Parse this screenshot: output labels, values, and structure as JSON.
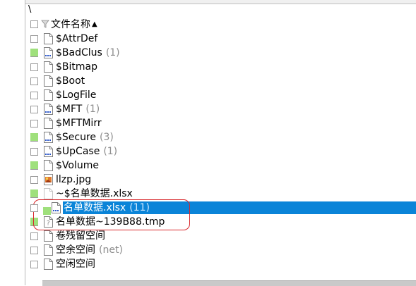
{
  "path": "\\",
  "header": {
    "column_label": "文件名称",
    "sort_indicator": "▲"
  },
  "files": [
    {
      "name": "$AttrDef",
      "count": "",
      "icon": "doc-icon",
      "marked": false
    },
    {
      "name": "$BadClus",
      "count": "(1)",
      "icon": "doc-multi-icon",
      "marked": true
    },
    {
      "name": "$Bitmap",
      "count": "",
      "icon": "doc-icon",
      "marked": false
    },
    {
      "name": "$Boot",
      "count": "",
      "icon": "doc-icon",
      "marked": false
    },
    {
      "name": "$LogFile",
      "count": "",
      "icon": "doc-icon",
      "marked": false
    },
    {
      "name": "$MFT",
      "count": "(1)",
      "icon": "doc-multi-icon",
      "marked": false
    },
    {
      "name": "$MFTMirr",
      "count": "",
      "icon": "doc-icon",
      "marked": false
    },
    {
      "name": "$Secure",
      "count": "(3)",
      "icon": "doc-multi-icon",
      "marked": true
    },
    {
      "name": "$UpCase",
      "count": "(1)",
      "icon": "doc-multi-icon",
      "marked": false
    },
    {
      "name": "$Volume",
      "count": "",
      "icon": "doc-icon",
      "marked": true
    },
    {
      "name": "llzp.jpg",
      "count": "",
      "icon": "image-icon",
      "marked": false
    },
    {
      "name": "~$名单数据.xlsx",
      "count": "",
      "icon": "doc-faded-icon",
      "marked": true
    },
    {
      "name": "名单数据.xlsx",
      "count": "(11)",
      "icon": "doc-multi-icon",
      "marked": true,
      "selected": true
    },
    {
      "name": "名单数据~139B88.tmp",
      "count": "",
      "icon": "unknown-doc-icon",
      "marked": true
    },
    {
      "name": "卷残留空间",
      "count": "",
      "icon": "doc-icon",
      "marked": false
    },
    {
      "name": "空余空间",
      "count": "(net)",
      "icon": "doc-icon",
      "marked": false
    },
    {
      "name": "空闲空间",
      "count": "",
      "icon": "doc-icon",
      "marked": false
    }
  ],
  "colors": {
    "selection": "#0a84d8",
    "marker": "#9fe07c",
    "annotation": "#d8262a"
  }
}
